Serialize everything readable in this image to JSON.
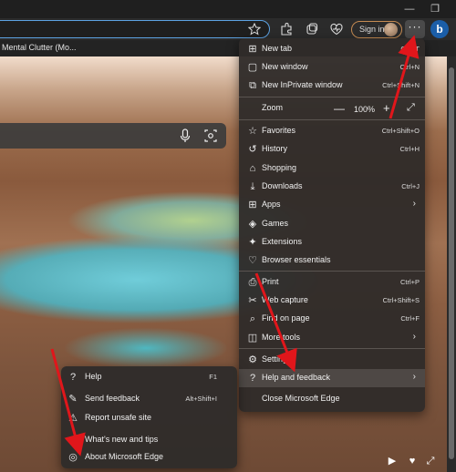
{
  "toolbar": {
    "signin_label": "Sign in",
    "more_label": "···",
    "bing_label": "b"
  },
  "favorites_bar": {
    "item_label": "Mental Clutter (Mo..."
  },
  "menu": {
    "items": [
      {
        "label": "New tab",
        "shortcut": "Ctrl+T"
      },
      {
        "label": "New window",
        "shortcut": "Ctrl+N"
      },
      {
        "label": "New InPrivate window",
        "shortcut": "Ctrl+Shift+N"
      },
      {
        "label": "Zoom",
        "shortcut": ""
      },
      {
        "label": "Favorites",
        "shortcut": "Ctrl+Shift+O"
      },
      {
        "label": "History",
        "shortcut": "Ctrl+H"
      },
      {
        "label": "Shopping",
        "shortcut": ""
      },
      {
        "label": "Downloads",
        "shortcut": "Ctrl+J"
      },
      {
        "label": "Apps",
        "shortcut": ""
      },
      {
        "label": "Games",
        "shortcut": ""
      },
      {
        "label": "Extensions",
        "shortcut": ""
      },
      {
        "label": "Browser essentials",
        "shortcut": ""
      },
      {
        "label": "Print",
        "shortcut": "Ctrl+P"
      },
      {
        "label": "Web capture",
        "shortcut": "Ctrl+Shift+S"
      },
      {
        "label": "Find on page",
        "shortcut": "Ctrl+F"
      },
      {
        "label": "More tools",
        "shortcut": ""
      },
      {
        "label": "Settings",
        "shortcut": ""
      },
      {
        "label": "Help and feedback",
        "shortcut": ""
      },
      {
        "label": "Close Microsoft Edge",
        "shortcut": ""
      }
    ],
    "zoom": {
      "minus": "—",
      "value": "100%",
      "plus": "+",
      "fullscreen": "⤢"
    }
  },
  "submenu": {
    "items": [
      {
        "label": "Help",
        "shortcut": "F1"
      },
      {
        "label": "Send feedback",
        "shortcut": "Alt+Shift+I"
      },
      {
        "label": "Report unsafe site",
        "shortcut": ""
      },
      {
        "label": "What's new and tips",
        "shortcut": ""
      },
      {
        "label": "About Microsoft Edge",
        "shortcut": ""
      }
    ]
  },
  "colors": {
    "accent_border": "#5da3e3",
    "annotation_arrow": "#e0161b",
    "menu_bg": "#302c2a"
  },
  "icons": [
    "star-icon",
    "extension-icon",
    "collections-icon",
    "heart-pulse-icon",
    "more-icon",
    "bing-icon",
    "mic-icon",
    "camera-search-icon"
  ]
}
